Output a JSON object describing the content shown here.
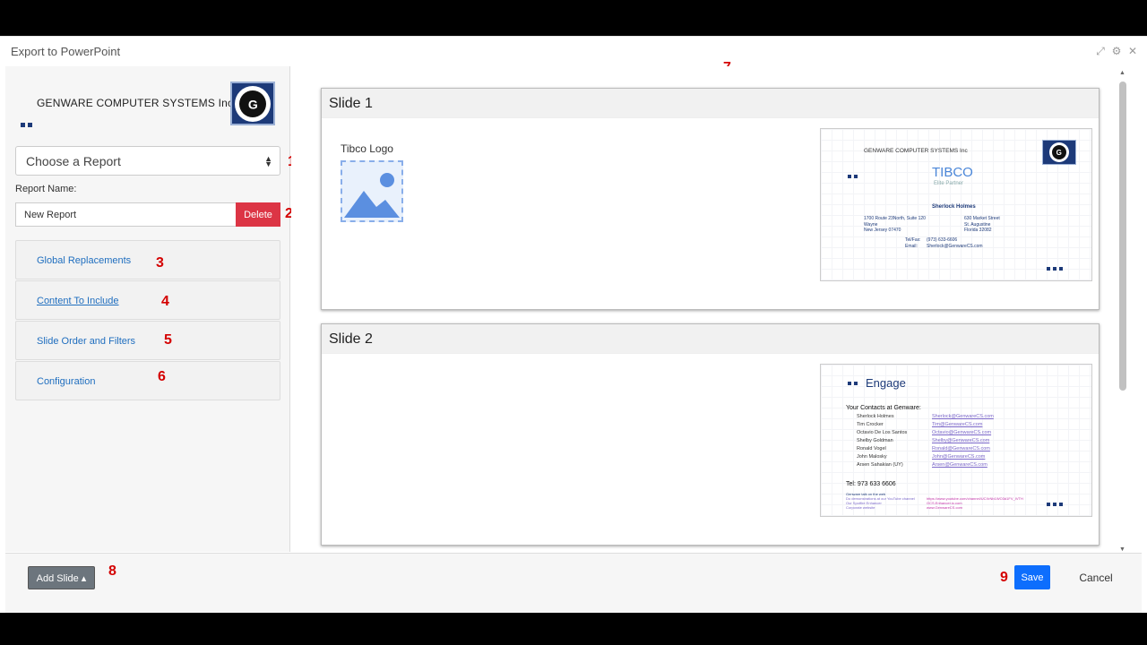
{
  "dialog": {
    "title": "Export to PowerPoint"
  },
  "window_controls": {
    "expand_icon": "expand-icon",
    "settings_icon": "gear-icon",
    "close_icon": "close-icon"
  },
  "sidebar": {
    "company_name": "GENWARE COMPUTER SYSTEMS Inc",
    "report_select": {
      "value": "Choose a Report"
    },
    "report_name_label": "Report Name:",
    "report_name_value": "New Report",
    "delete_label": "Delete",
    "sections": [
      {
        "label": "Global Replacements"
      },
      {
        "label": "Content To Include"
      },
      {
        "label": "Slide Order and Filters"
      },
      {
        "label": "Configuration"
      }
    ]
  },
  "annotations": [
    "1",
    "2",
    "3",
    "4",
    "5",
    "6",
    "7",
    "8",
    "9"
  ],
  "slides": [
    {
      "title": "Slide 1",
      "placeholder_label": "Tibco Logo",
      "thumbnail": {
        "company": "GENWARE COMPUTER SYSTEMS Inc",
        "brand": "TIBCO",
        "brand_sub": "Elite Partner",
        "person": "Sherlock Holmes",
        "addr_left": [
          "1700 Route 23North, Suite 120",
          "Wayne",
          "New Jersey 07470"
        ],
        "addr_right": [
          "630 Market Street",
          "St. Augustine",
          "Florida 32082"
        ],
        "tel_label": "Tel/Fax:",
        "tel": "(973) 633-6606",
        "email_label": "Email:",
        "email": "Sherlock@GenwareCS.com"
      }
    },
    {
      "title": "Slide 2",
      "thumbnail": {
        "heading": "Engage",
        "contacts_title": "Your Contacts at Genware:",
        "contacts": [
          {
            "name": "Sherlock Holmes",
            "email": "Sherlock@GenwareCS.com"
          },
          {
            "name": "Tim Crocker",
            "email": "Tim@GenwareCS.com"
          },
          {
            "name": "Octavio De Los Santos",
            "email": "Octavio@GenwareCS.com"
          },
          {
            "name": "Shelby Goldman",
            "email": "Shelby@GenwareCS.com"
          },
          {
            "name": "Ronald Vogel",
            "email": "Ronald@GenwareCS.com"
          },
          {
            "name": "John Malosky",
            "email": "John@GenwareCS.com"
          },
          {
            "name": "Arsen Sahakian (UY)",
            "email": "Arsen@GenwareCS.com"
          }
        ],
        "tel": "Tel: 973 633 6606",
        "footer_left": [
          "Genware talk on the web",
          "Do demonstrations at our YouTube channel",
          "Our Spotfire Enhancer",
          "Corporate website"
        ],
        "footer_right": [
          "https://www.youtube.com/channel/UCXrNb1WO3d1FV_IVTH",
          "GCS.Enhancer.io.com",
          "www.GenwareCS.com"
        ]
      }
    }
  ],
  "footer": {
    "add_slide_label": "Add Slide ▴",
    "save_label": "Save",
    "cancel_label": "Cancel"
  },
  "colors": {
    "accent": "#0d6efd",
    "danger": "#dc3545",
    "brand_navy": "#1d3a79",
    "annotation": "#d40000"
  }
}
